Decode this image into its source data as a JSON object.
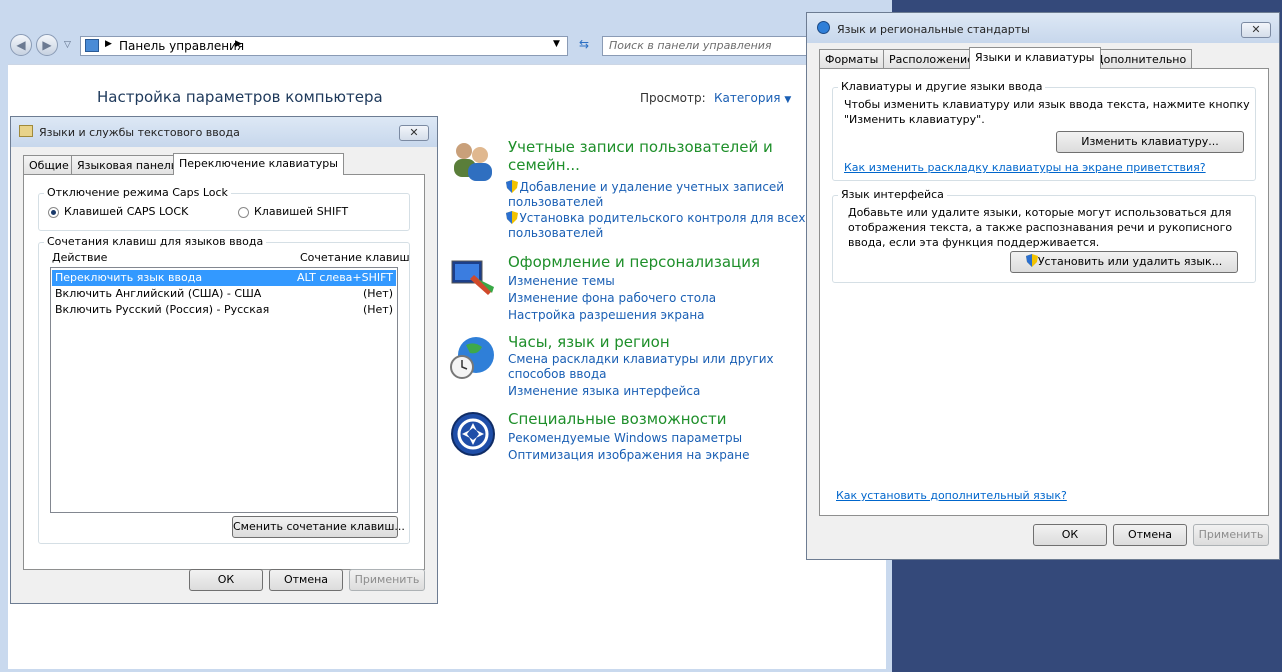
{
  "control_panel": {
    "breadcrumb": "Панель управления",
    "search_placeholder": "Поиск в панели управления",
    "page_title": "Настройка параметров компьютера",
    "view_by_label": "Просмотр:",
    "view_by_value": "Категория",
    "categories": [
      {
        "title_line1": "Учетные записи пользователей и",
        "title_line2": "семейн...",
        "links": [
          "Добавление и удаление учетных записей",
          "пользователей",
          "Установка родительского контроля для всех",
          "пользователей"
        ]
      },
      {
        "title": "Оформление и персонализация",
        "links": [
          "Изменение темы",
          "Изменение фона рабочего стола",
          "Настройка разрешения экрана"
        ]
      },
      {
        "title": "Часы, язык и регион",
        "links": [
          "Смена раскладки клавиатуры или других",
          "способов ввода",
          "Изменение языка интерфейса"
        ]
      },
      {
        "title": "Специальные возможности",
        "links": [
          "Рекомендуемые Windows параметры",
          "Оптимизация изображения на экране"
        ]
      }
    ]
  },
  "text_services": {
    "title": "Языки и службы текстового ввода",
    "close": "✕",
    "tabs": [
      "Общие",
      "Языковая панель",
      "Переключение клавиатуры"
    ],
    "caps_group": "Отключение режима Caps Lock",
    "radio_caps": "Клавишей CAPS LOCK",
    "radio_shift": "Клавишей SHIFT",
    "hotkeys_group": "Сочетания клавиш для языков ввода",
    "col_action": "Действие",
    "col_keys": "Сочетание клавиш",
    "rows": [
      {
        "action": "Переключить язык ввода",
        "keys": "ALT слева+SHIFT"
      },
      {
        "action": "Включить Английский (США) - США",
        "keys": "(Нет)"
      },
      {
        "action": "Включить Русский (Россия) - Русская",
        "keys": "(Нет)"
      }
    ],
    "change_btn": "Сменить сочетание клавиш...",
    "ok": "ОК",
    "cancel": "Отмена",
    "apply": "Применить"
  },
  "regional": {
    "title": "Язык и региональные стандарты",
    "close": "✕",
    "tabs": [
      "Форматы",
      "Расположение",
      "Языки и клавиатуры",
      "Дополнительно"
    ],
    "kb_group": "Клавиатуры и другие языки ввода",
    "kb_text1": "Чтобы изменить клавиатуру или язык ввода текста, нажмите кнопку",
    "kb_text2": "\"Изменить клавиатуру\".",
    "kb_btn": "Изменить клавиатуру...",
    "kb_link": "Как изменить раскладку клавиатуры на экране приветствия?",
    "ui_group": "Язык интерфейса",
    "ui_text1": "Добавьте или удалите языки, которые могут использоваться для",
    "ui_text2": "отображения текста, а также распознавания речи и рукописного",
    "ui_text3": "ввода, если эта функция поддерживается.",
    "ui_btn": "Установить или удалить язык...",
    "extra_link": "Как установить дополнительный язык?",
    "ok": "ОК",
    "cancel": "Отмена",
    "apply": "Применить"
  }
}
